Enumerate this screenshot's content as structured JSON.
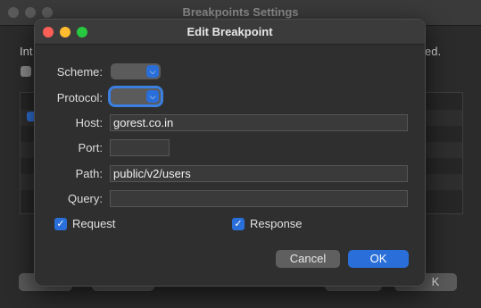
{
  "background_window": {
    "title": "Breakpoints Settings",
    "text_left": "Int",
    "text_right": "ed.",
    "right_button_partial": "K"
  },
  "dialog": {
    "title": "Edit Breakpoint",
    "scheme_label": "Scheme:",
    "protocol_label": "Protocol:",
    "host_label": "Host:",
    "host_value": "gorest.co.in",
    "port_label": "Port:",
    "port_value": "",
    "path_label": "Path:",
    "path_value": "public/v2/users",
    "query_label": "Query:",
    "query_value": "",
    "request_label": "Request",
    "request_checked": true,
    "response_label": "Response",
    "response_checked": true,
    "cancel_label": "Cancel",
    "ok_label": "OK"
  },
  "icons": {
    "popup_arrow": "chevron-down-icon",
    "check": "checkmark-icon"
  },
  "colors": {
    "accent": "#2a6fd9",
    "close": "#ff5f57",
    "minimize": "#febc2e",
    "maximize": "#28c840"
  }
}
